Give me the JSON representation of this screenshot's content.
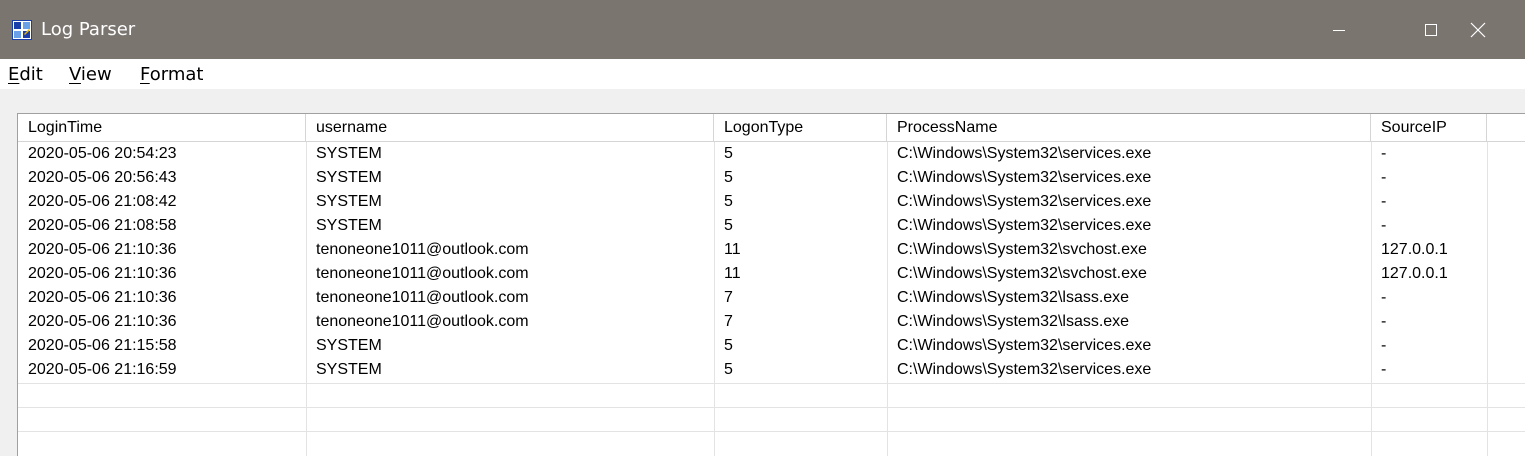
{
  "window": {
    "title": "Log Parser",
    "icon": "app-grid-icon",
    "controls": {
      "minimize": "minimize-icon",
      "maximize": "maximize-icon",
      "close": "close-icon"
    },
    "colors": {
      "titlebar_bg": "#7b7570",
      "titlebar_fg": "#ffffff"
    }
  },
  "menu": {
    "items": [
      {
        "label": "Edit"
      },
      {
        "label": "View"
      },
      {
        "label": "Format"
      }
    ]
  },
  "table": {
    "columns": [
      "LoginTime",
      "username",
      "LogonType",
      "ProcessName",
      "SourceIP"
    ],
    "rows": [
      [
        "2020-05-06 20:54:23",
        "SYSTEM",
        "5",
        "C:\\Windows\\System32\\services.exe",
        "-"
      ],
      [
        "2020-05-06 20:56:43",
        "SYSTEM",
        "5",
        "C:\\Windows\\System32\\services.exe",
        "-"
      ],
      [
        "2020-05-06 21:08:42",
        "SYSTEM",
        "5",
        "C:\\Windows\\System32\\services.exe",
        "-"
      ],
      [
        "2020-05-06 21:08:58",
        "SYSTEM",
        "5",
        "C:\\Windows\\System32\\services.exe",
        "-"
      ],
      [
        "2020-05-06 21:10:36",
        "tenoneone1011@outlook.com",
        "11",
        "C:\\Windows\\System32\\svchost.exe",
        "127.0.0.1"
      ],
      [
        "2020-05-06 21:10:36",
        "tenoneone1011@outlook.com",
        "11",
        "C:\\Windows\\System32\\svchost.exe",
        "127.0.0.1"
      ],
      [
        "2020-05-06 21:10:36",
        "tenoneone1011@outlook.com",
        "7",
        "C:\\Windows\\System32\\lsass.exe",
        "-"
      ],
      [
        "2020-05-06 21:10:36",
        "tenoneone1011@outlook.com",
        "7",
        "C:\\Windows\\System32\\lsass.exe",
        "-"
      ],
      [
        "2020-05-06 21:15:58",
        "SYSTEM",
        "5",
        "C:\\Windows\\System32\\services.exe",
        "-"
      ],
      [
        "2020-05-06 21:16:59",
        "SYSTEM",
        "5",
        "C:\\Windows\\System32\\services.exe",
        "-"
      ]
    ]
  }
}
